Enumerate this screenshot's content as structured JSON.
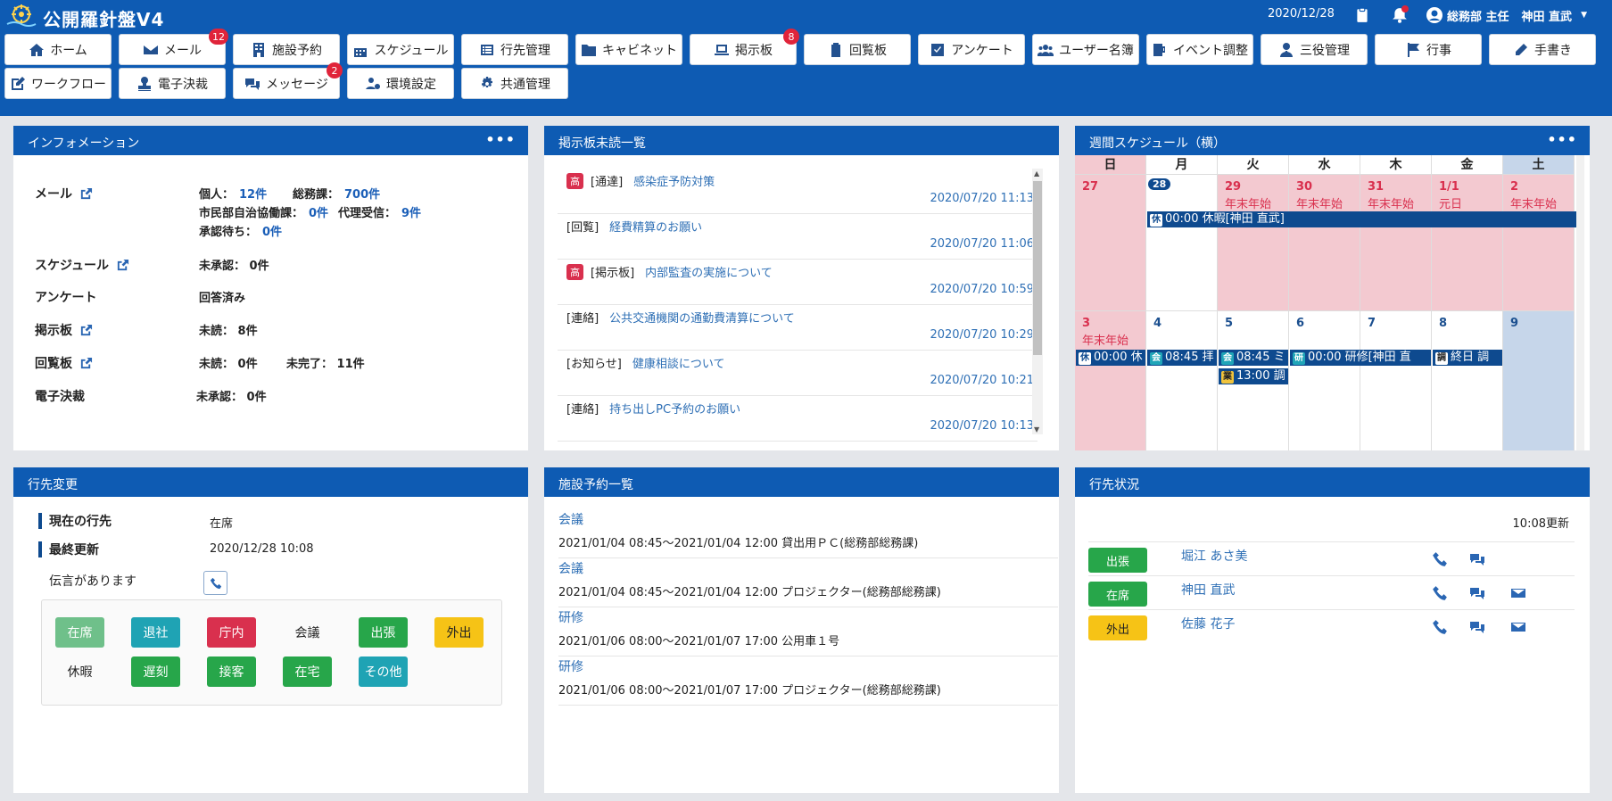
{
  "header": {
    "title": "公開羅針盤V4",
    "date": "2020/12/28",
    "user": "総務部 主任",
    "user_name": "神田 直武"
  },
  "nav": {
    "items": [
      {
        "label": "ホーム",
        "icon": "home-icon"
      },
      {
        "label": "メール",
        "icon": "mail-icon",
        "badge": "12"
      },
      {
        "label": "施設予約",
        "icon": "building-icon"
      },
      {
        "label": "スケジュール",
        "icon": "calendar-icon"
      },
      {
        "label": "行先管理",
        "icon": "list-icon"
      },
      {
        "label": "キャビネット",
        "icon": "folder-icon"
      },
      {
        "label": "掲示板",
        "icon": "laptop-icon",
        "badge": "8"
      },
      {
        "label": "回覧板",
        "icon": "clipboard-icon"
      },
      {
        "label": "アンケート",
        "icon": "check-square-icon"
      },
      {
        "label": "ユーザー名簿",
        "icon": "users-icon"
      },
      {
        "label": "イベント調整",
        "icon": "mug-icon"
      },
      {
        "label": "三役管理",
        "icon": "user-tie-icon"
      },
      {
        "label": "行事",
        "icon": "flag-icon"
      },
      {
        "label": "手書き",
        "icon": "pen-icon"
      },
      {
        "label": "ワークフロー",
        "icon": "edit-icon"
      },
      {
        "label": "電子決裁",
        "icon": "stamp-icon"
      },
      {
        "label": "メッセージ",
        "icon": "comments-icon",
        "badge": "2"
      },
      {
        "label": "環境設定",
        "icon": "users-cog-icon"
      },
      {
        "label": "共通管理",
        "icon": "cog-icon"
      }
    ]
  },
  "info": {
    "title": "インフォメーション",
    "mail_label": "メール",
    "mail_personal": "個人：",
    "mail_personal_n": "12件",
    "mail_dept": "総務課：",
    "mail_dept_n": "700件",
    "mail_city": "市民部自治協働課：",
    "mail_city_n": "0件",
    "mail_proxy": "代理受信：",
    "mail_proxy_n": "9件",
    "mail_wait": "承認待ち：",
    "mail_wait_n": "0件",
    "sched_label": "スケジュール",
    "sched_val": "未承認： 0件",
    "survey_label": "アンケート",
    "survey_val": "回答済み",
    "bb_label": "掲示板",
    "bb_val": "未読： 8件",
    "circ_label": "回覧板",
    "circ_val1": "未読： 0件",
    "circ_val2": "未完了： 11件",
    "esign_label": "電子決裁",
    "esign_val": "未承認： 0件"
  },
  "bulletin": {
    "title": "掲示板未読一覧",
    "items": [
      {
        "hi": "高",
        "cat": "[通達]",
        "title": "感染症予防対策",
        "date": "2020/07/20 11:13"
      },
      {
        "hi": "",
        "cat": "[回覧]",
        "title": "経費精算のお願い",
        "date": "2020/07/20 11:06"
      },
      {
        "hi": "高",
        "cat": "[掲示板]",
        "title": "内部監査の実施について",
        "date": "2020/07/20 10:59"
      },
      {
        "hi": "",
        "cat": "[連絡]",
        "title": "公共交通機関の通勤費清算について",
        "date": "2020/07/20 10:29"
      },
      {
        "hi": "",
        "cat": "[お知らせ]",
        "title": "健康相談について",
        "date": "2020/07/20 10:21"
      },
      {
        "hi": "",
        "cat": "[連絡]",
        "title": "持ち出しPC予約のお願い",
        "date": "2020/07/20 10:13"
      }
    ]
  },
  "weekly": {
    "title": "週間スケジュール（横）",
    "weekdays": [
      "日",
      "月",
      "火",
      "水",
      "木",
      "金",
      "土"
    ],
    "week1": [
      {
        "d": "27",
        "hol": ""
      },
      {
        "d": "28",
        "hol": ""
      },
      {
        "d": "29",
        "hol": "年末年始"
      },
      {
        "d": "30",
        "hol": "年末年始"
      },
      {
        "d": "31",
        "hol": "年末年始"
      },
      {
        "d": "1/1",
        "hol": "元日"
      },
      {
        "d": "2",
        "hol": "年末年始"
      }
    ],
    "week2": [
      {
        "d": "3",
        "hol": "年末年始"
      },
      {
        "d": "4",
        "hol": ""
      },
      {
        "d": "5",
        "hol": ""
      },
      {
        "d": "6",
        "hol": ""
      },
      {
        "d": "7",
        "hol": ""
      },
      {
        "d": "8",
        "hol": ""
      },
      {
        "d": "9",
        "hol": ""
      }
    ],
    "events": {
      "w1_span_tag": "休",
      "w1_span_text": "00:00 休暇[神田 直武]",
      "w2_sun_tag": "休",
      "w2_sun_text": "00:00 休",
      "w2_mon_tag": "会",
      "w2_mon_text": "08:45 拝",
      "w2_tue_tag": "会",
      "w2_tue_text": "08:45 ミ",
      "w2_tue2_tag": "業",
      "w2_tue2_text": "13:00 調",
      "w2_wed_tag": "研",
      "w2_wed_text": "00:00 研修[神田 直",
      "w2_fri_tag": "調",
      "w2_fri_text": "終日 調"
    }
  },
  "dest": {
    "title": "行先変更",
    "current_label": "現在の行先",
    "current_val": "在席",
    "updated_label": "最終更新",
    "updated_val": "2020/12/28 10:08",
    "message": "伝言があります",
    "statuses": [
      {
        "label": "在席",
        "color": "#6fc08a"
      },
      {
        "label": "退社",
        "color": "#1fa3b4"
      },
      {
        "label": "庁内",
        "color": "#d9304e"
      },
      {
        "label": "会議",
        "color": "transparent",
        "dark": true
      },
      {
        "label": "出張",
        "color": "#27a64a"
      },
      {
        "label": "外出",
        "color": "#f6c316",
        "dark": true
      },
      {
        "label": "休暇",
        "color": "transparent",
        "dark": true
      },
      {
        "label": "遅刻",
        "color": "#27a64a"
      },
      {
        "label": "接客",
        "color": "#27a64a"
      },
      {
        "label": "在宅",
        "color": "#27a64a"
      },
      {
        "label": "その他",
        "color": "#1fa3b4"
      }
    ]
  },
  "facility": {
    "title": "施設予約一覧",
    "items": [
      {
        "type": "会議",
        "detail": "2021/01/04 08:45～2021/01/04 12:00  貸出用ＰＣ(総務部総務課)"
      },
      {
        "type": "会議",
        "detail": "2021/01/04 08:45～2021/01/04 12:00  プロジェクター(総務部総務課)"
      },
      {
        "type": "研修",
        "detail": "2021/01/06 08:00～2021/01/07 17:00  公用車１号"
      },
      {
        "type": "研修",
        "detail": "2021/01/06 08:00～2021/01/07 17:00  プロジェクター(総務部総務課)"
      }
    ]
  },
  "where": {
    "title": "行先状況",
    "updated": "10:08更新",
    "rows": [
      {
        "status": "出張",
        "color": "#27a64a",
        "name": "堀江 あさ美",
        "mail": false
      },
      {
        "status": "在席",
        "color": "#27a64a",
        "name": "神田 直武",
        "mail": true
      },
      {
        "status": "外出",
        "color": "#f6c316",
        "name": "佐藤 花子",
        "mail": true
      }
    ]
  }
}
